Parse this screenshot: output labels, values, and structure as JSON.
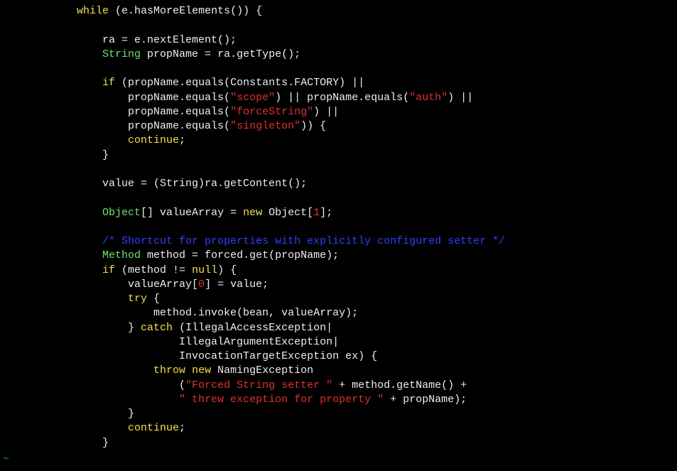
{
  "code": {
    "indent": "            ",
    "t01a": "while",
    "t01b": " (e.hasMoreElements()) {",
    "blank": "",
    "t03": "                ra = e.nextElement();",
    "t04a": "                ",
    "t04b": "String",
    "t04c": " propName = ra.getType();",
    "t06a": "                ",
    "t06b": "if",
    "t06c": " (propName.equals(Constants.FACTORY) ||",
    "t07a": "                    propName.equals(",
    "t07s": "\"scope\"",
    "t07b": ") || propName.equals(",
    "t07t": "\"auth\"",
    "t07c": ") ||",
    "t08a": "                    propName.equals(",
    "t08s": "\"forceString\"",
    "t08b": ") ||",
    "t09a": "                    propName.equals(",
    "t09s": "\"singleton\"",
    "t09b": ")) {",
    "t10a": "                    ",
    "t10b": "continue",
    "t10c": ";",
    "t11": "                }",
    "t13": "                value = (String)ra.getContent();",
    "t15a": "                ",
    "t15b": "Object",
    "t15c": "[] valueArray = ",
    "t15d": "new",
    "t15e": " Object[",
    "t15n": "1",
    "t15f": "];",
    "t17a": "                ",
    "t17c": "/* Shortcut for properties with explicitly configured setter */",
    "t18a": "                ",
    "t18b": "Method",
    "t18c": " method = forced.get(propName);",
    "t19a": "                ",
    "t19b": "if",
    "t19c": " (method != ",
    "t19d": "null",
    "t19e": ") {",
    "t20a": "                    valueArray[",
    "t20n": "0",
    "t20b": "] = value;",
    "t21a": "                    ",
    "t21b": "try",
    "t21c": " {",
    "t22": "                        method.invoke(bean, valueArray);",
    "t23a": "                    } ",
    "t23b": "catch",
    "t23c": " (IllegalAccessException|",
    "t24": "                            IllegalArgumentException|",
    "t25": "                            InvocationTargetException ex) {",
    "t26a": "                        ",
    "t26b": "throw",
    "t26c": " ",
    "t26d": "new",
    "t26e": " NamingException",
    "t27a": "                            (",
    "t27s": "\"Forced String setter \"",
    "t27b": " + method.getName() +",
    "t28a": "                            ",
    "t28s": "\" threw exception for property \"",
    "t28b": " + propName);",
    "t29": "                    }",
    "t30a": "                    ",
    "t30b": "continue",
    "t30c": ";",
    "t31": "                }"
  },
  "tilde": "~"
}
